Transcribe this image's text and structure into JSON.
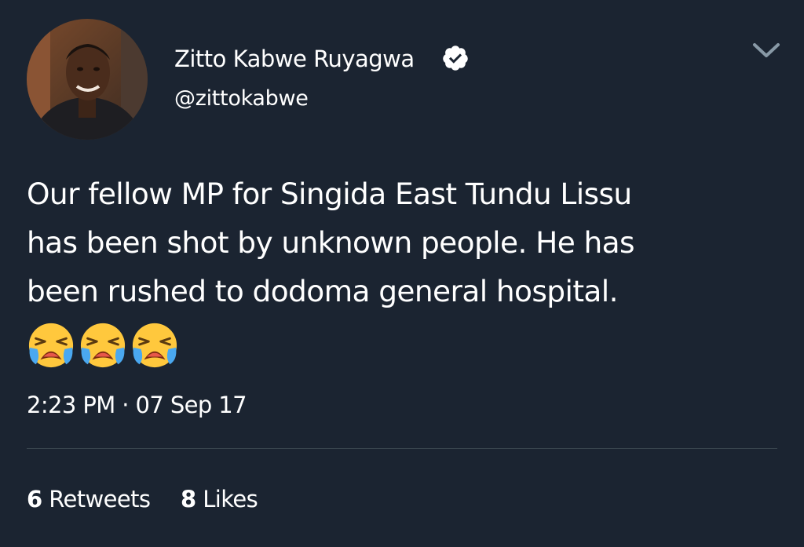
{
  "user": {
    "display_name": "Zitto Kabwe Ruyagwa",
    "handle": "@zittokabwe",
    "verified_icon": "verified-badge-icon"
  },
  "tweet": {
    "lines": [
      "Our fellow MP for Singida East Tundu Lissu",
      "has been shot by unknown people. He has",
      "been rushed to dodoma general hospital."
    ],
    "emoji_icons": [
      "loudly-crying-face-icon",
      "loudly-crying-face-icon",
      "loudly-crying-face-icon"
    ],
    "timestamp": "2:23 PM · 07 Sep 17"
  },
  "stats": {
    "retweets_count": "6",
    "retweets_label": "Retweets",
    "likes_count": "8",
    "likes_label": "Likes"
  },
  "colors": {
    "background": "#1b2431",
    "text": "#ffffff",
    "divider": "#38444d",
    "chevron": "#8899a6"
  }
}
